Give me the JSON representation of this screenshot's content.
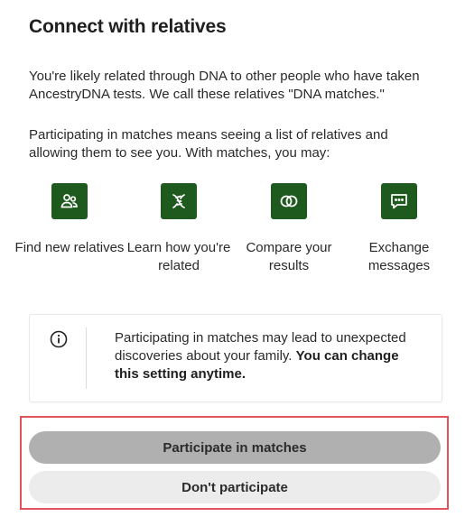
{
  "title": "Connect with relatives",
  "intro": {
    "p1": "You're likely related through DNA to other people who have taken AncestryDNA tests. We call these relatives \"DNA matches.\"",
    "p2": "Participating in matches means seeing a list of relatives and allowing them to see you. With matches, you may:"
  },
  "features": [
    {
      "icon": "people-icon",
      "label": "Find new relatives"
    },
    {
      "icon": "dna-icon",
      "label": "Learn how you're related"
    },
    {
      "icon": "compare-circles-icon",
      "label": "Compare your results"
    },
    {
      "icon": "message-icon",
      "label": "Exchange messages"
    }
  ],
  "notice": {
    "icon": "info-icon",
    "text": "Participating in matches may lead to unexpected discoveries about your family. ",
    "bold": "You can change this setting anytime."
  },
  "buttons": {
    "participate": "Participate in matches",
    "decline": "Don't participate"
  },
  "colors": {
    "icon_bg": "#1e5a1e",
    "highlight_border": "#e2535e",
    "primary_button": "#b0b0b0",
    "secondary_button": "#ececec"
  }
}
